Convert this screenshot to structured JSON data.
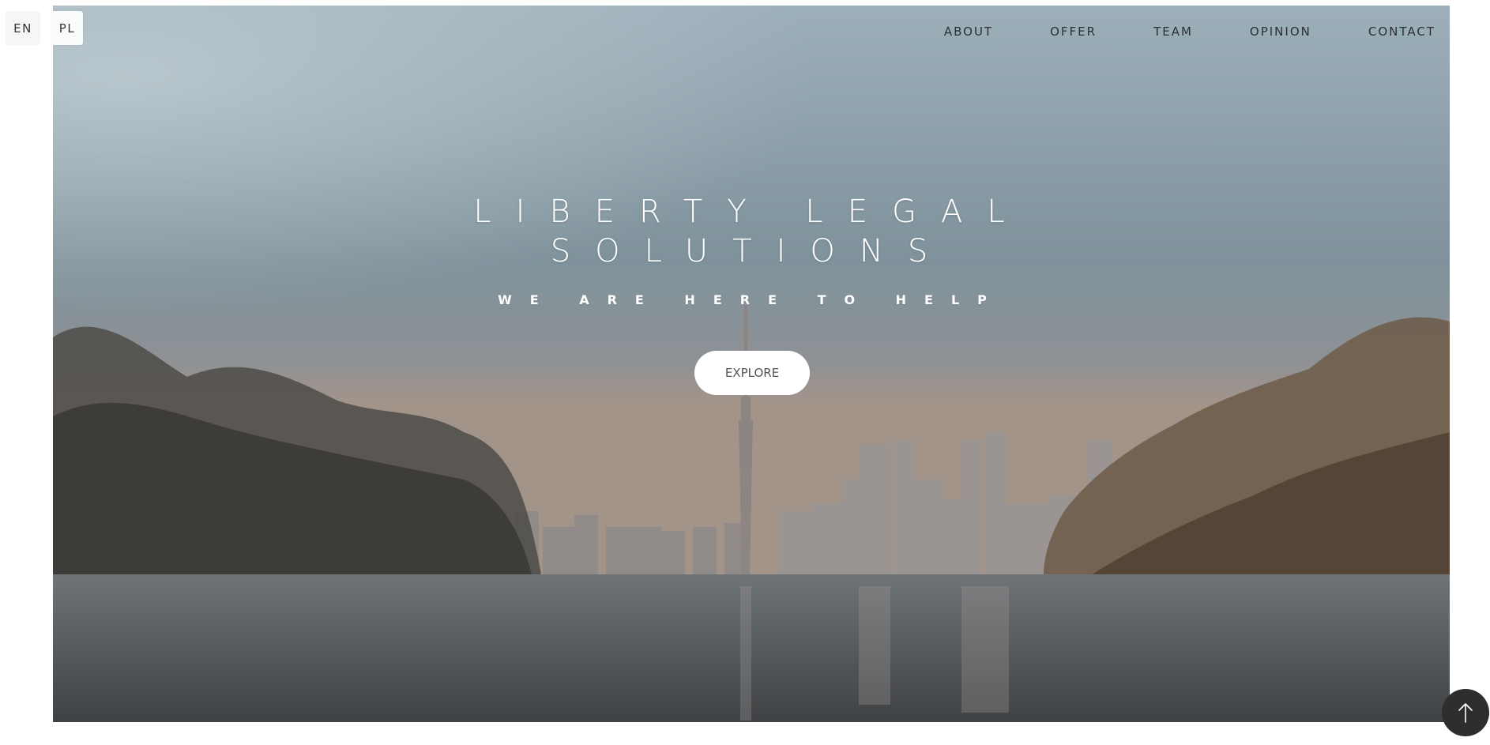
{
  "language_switch": {
    "options": [
      "EN",
      "PL"
    ],
    "selected": "PL"
  },
  "nav": {
    "items": [
      {
        "label": "ABOUT"
      },
      {
        "label": "OFFER"
      },
      {
        "label": "TEAM"
      },
      {
        "label": "OPINION"
      },
      {
        "label": "CONTACT"
      }
    ]
  },
  "hero": {
    "title_line1": "LIBERTY LEGAL",
    "title_line2": "SOLUTIONS",
    "subtitle": "WE ARE HERE TO HELP",
    "button_label": "EXPLORE",
    "background_icon": "city-skyline-lake-photo"
  },
  "scroll_top": {
    "icon": "arrow-up-icon"
  }
}
